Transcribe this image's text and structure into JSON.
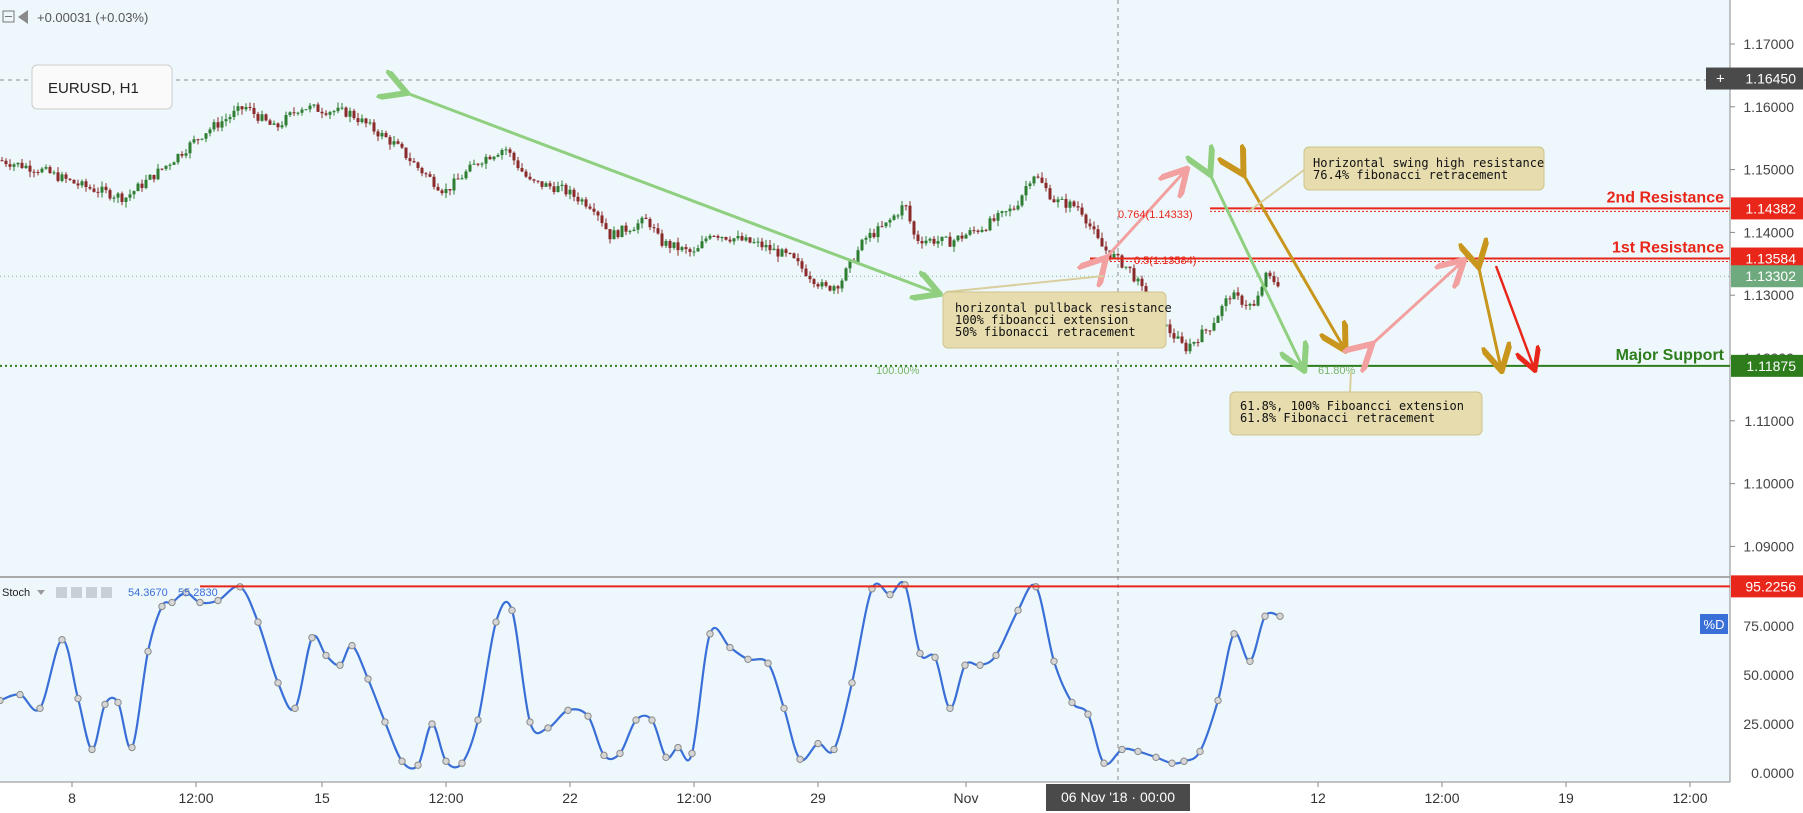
{
  "header": {
    "change": "+0.00031 (+0.03%)",
    "symbol": "EURUSD, H1"
  },
  "indicator": {
    "name": "Stoch",
    "k_value": "54.3670",
    "d_value": "55.2830",
    "d_badge": "%D"
  },
  "crosshair_label": "06 Nov '18 · 00:00",
  "colors": {
    "background": "#eef8fc",
    "up_candle": "#2e7d32",
    "down_candle": "#8b2a2a",
    "resistance": "#e8261a",
    "support": "#2e7d1c",
    "stoch": "#3a6fd8",
    "arrow_green": "#8fcf7f",
    "arrow_gold": "#c9961d",
    "arrow_pink": "#f2a0a0"
  },
  "chart_data": [
    {
      "type": "candlestick",
      "ylim": [
        1.08,
        1.175
      ],
      "y_ticks": [
        "1.17000",
        "1.16000",
        "1.15000",
        "1.14000",
        "1.13000",
        "1.12000",
        "1.11000",
        "1.10000",
        "1.09000"
      ],
      "x_ticks": [
        "8",
        "12:00",
        "15",
        "12:00",
        "22",
        "12:00",
        "29",
        "Nov",
        "12",
        "12:00",
        "19",
        "12:00"
      ],
      "price_path": [
        [
          0,
          1.1515
        ],
        [
          40,
          1.15
        ],
        [
          80,
          1.1475
        ],
        [
          125,
          1.1455
        ],
        [
          165,
          1.1505
        ],
        [
          205,
          1.156
        ],
        [
          245,
          1.16
        ],
        [
          275,
          1.1565
        ],
        [
          300,
          1.16
        ],
        [
          350,
          1.159
        ],
        [
          395,
          1.154
        ],
        [
          420,
          1.15
        ],
        [
          445,
          1.1465
        ],
        [
          480,
          1.1515
        ],
        [
          505,
          1.1535
        ],
        [
          530,
          1.148
        ],
        [
          560,
          1.147
        ],
        [
          595,
          1.144
        ],
        [
          610,
          1.1395
        ],
        [
          648,
          1.142
        ],
        [
          660,
          1.1385
        ],
        [
          695,
          1.1365
        ],
        [
          710,
          1.14
        ],
        [
          760,
          1.138
        ],
        [
          790,
          1.136
        ],
        [
          825,
          1.131
        ],
        [
          840,
          1.132
        ],
        [
          865,
          1.139
        ],
        [
          885,
          1.141
        ],
        [
          905,
          1.1445
        ],
        [
          915,
          1.139
        ],
        [
          950,
          1.1385
        ],
        [
          985,
          1.141
        ],
        [
          1015,
          1.144
        ],
        [
          1033,
          1.1495
        ],
        [
          1055,
          1.145
        ],
        [
          1080,
          1.144
        ],
        [
          1100,
          1.138
        ],
        [
          1130,
          1.134
        ],
        [
          1160,
          1.126
        ],
        [
          1185,
          1.1215
        ],
        [
          1210,
          1.125
        ],
        [
          1230,
          1.13
        ],
        [
          1255,
          1.128
        ],
        [
          1265,
          1.133
        ],
        [
          1278,
          1.132
        ]
      ],
      "levels": [
        {
          "name": "2nd Resistance",
          "value": "1.14382",
          "kind": "resistance"
        },
        {
          "name": "1st Resistance",
          "value": "1.13584",
          "kind": "resistance"
        },
        {
          "name": "Major Support",
          "value": "1.11875",
          "kind": "support"
        }
      ],
      "current_price": "1.13302",
      "crosshair_price": "1.16450",
      "annotations": [
        {
          "lines": [
            "horizontal pullback resistance",
            "100% fiboancci extension",
            "50% fibonacci retracement"
          ]
        },
        {
          "lines": [
            "Horizontal swing high resistance",
            "76.4% fibonacci retracement"
          ]
        },
        {
          "lines": [
            "61.8%, 100% Fiboancci extension",
            "61.8% Fibonacci retracement"
          ]
        }
      ],
      "fib_labels": [
        "0.764(1.14333)",
        "0.5(1.13584)",
        "100.00%",
        "61.80%"
      ]
    },
    {
      "type": "line",
      "name": "Stoch",
      "ylim": [
        0,
        100
      ],
      "y_ticks": [
        "75.0000",
        "50.0000",
        "25.0000",
        "0.0000"
      ],
      "level_label": "95.2256",
      "level_value": 95.2256,
      "current_label": "75.0000",
      "points": [
        [
          0,
          37
        ],
        [
          20,
          40
        ],
        [
          40,
          33
        ],
        [
          62,
          68
        ],
        [
          78,
          38
        ],
        [
          92,
          12
        ],
        [
          105,
          35
        ],
        [
          118,
          36
        ],
        [
          132,
          13
        ],
        [
          148,
          62
        ],
        [
          162,
          85
        ],
        [
          172,
          87
        ],
        [
          186,
          92
        ],
        [
          200,
          87
        ],
        [
          218,
          88
        ],
        [
          240,
          95
        ],
        [
          258,
          77
        ],
        [
          278,
          46
        ],
        [
          295,
          33
        ],
        [
          312,
          69
        ],
        [
          326,
          60
        ],
        [
          340,
          55
        ],
        [
          352,
          65
        ],
        [
          368,
          48
        ],
        [
          385,
          26
        ],
        [
          402,
          6
        ],
        [
          418,
          4
        ],
        [
          432,
          25
        ],
        [
          446,
          6
        ],
        [
          462,
          5
        ],
        [
          478,
          27
        ],
        [
          496,
          77
        ],
        [
          512,
          83
        ],
        [
          530,
          26
        ],
        [
          548,
          23
        ],
        [
          568,
          32
        ],
        [
          588,
          29
        ],
        [
          604,
          9
        ],
        [
          620,
          10
        ],
        [
          636,
          27
        ],
        [
          652,
          27
        ],
        [
          666,
          8
        ],
        [
          678,
          13
        ],
        [
          692,
          10
        ],
        [
          710,
          71
        ],
        [
          730,
          64
        ],
        [
          748,
          58
        ],
        [
          768,
          56
        ],
        [
          784,
          33
        ],
        [
          800,
          7
        ],
        [
          818,
          15
        ],
        [
          834,
          12
        ],
        [
          852,
          46
        ],
        [
          872,
          94
        ],
        [
          890,
          91
        ],
        [
          905,
          96
        ],
        [
          920,
          61
        ],
        [
          935,
          59
        ],
        [
          950,
          33
        ],
        [
          965,
          55
        ],
        [
          980,
          55
        ],
        [
          996,
          60
        ],
        [
          1018,
          83
        ],
        [
          1036,
          95
        ],
        [
          1054,
          57
        ],
        [
          1072,
          36
        ],
        [
          1088,
          30
        ],
        [
          1104,
          5
        ],
        [
          1122,
          12
        ],
        [
          1138,
          11
        ],
        [
          1156,
          8
        ],
        [
          1172,
          5
        ],
        [
          1184,
          6
        ],
        [
          1200,
          11
        ],
        [
          1218,
          37
        ],
        [
          1234,
          71
        ],
        [
          1250,
          57
        ],
        [
          1265,
          80
        ],
        [
          1280,
          80
        ]
      ]
    }
  ]
}
